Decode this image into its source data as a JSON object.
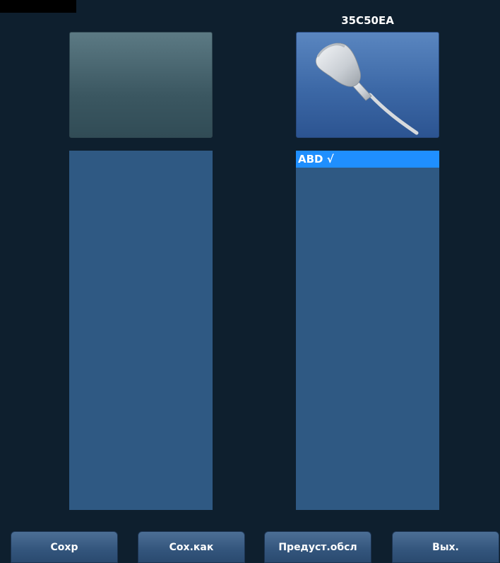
{
  "probes": {
    "left": {
      "name": "",
      "exams": []
    },
    "right": {
      "name": "35C50EA",
      "exams": [
        {
          "label": "ABD √",
          "selected": true
        }
      ]
    }
  },
  "buttons": {
    "save": "Сохр",
    "save_as": "Сох.как",
    "preset": "Предуст.обсл",
    "exit": "Вых."
  },
  "icons": {
    "probe_right": "convex-probe-icon"
  },
  "colors": {
    "background": "#0e1f2e",
    "list": "#2f5983",
    "selected": "#1f8fff"
  }
}
